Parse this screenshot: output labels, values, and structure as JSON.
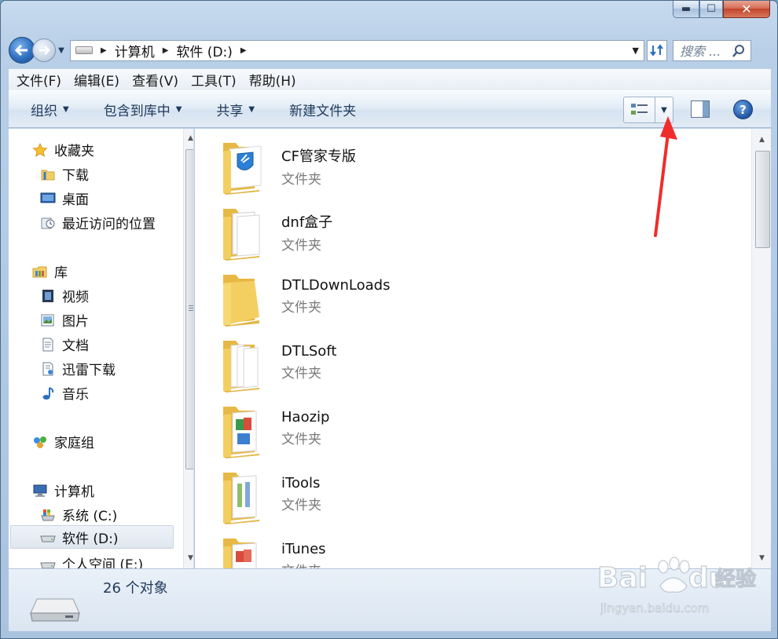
{
  "window": {
    "caption_buttons": {
      "minimize": "▬",
      "maximize": "☐",
      "close": "✕"
    }
  },
  "address_bar": {
    "breadcrumb": [
      "计算机",
      "软件 (D:)"
    ],
    "search_placeholder": "搜索 ..."
  },
  "menu": [
    "文件(F)",
    "编辑(E)",
    "查看(V)",
    "工具(T)",
    "帮助(H)"
  ],
  "toolbar": {
    "commands": [
      {
        "label": "组织",
        "has_dropdown": true
      },
      {
        "label": "包含到库中",
        "has_dropdown": true
      },
      {
        "label": "共享",
        "has_dropdown": true
      },
      {
        "label": "新建文件夹",
        "has_dropdown": false
      }
    ],
    "help_label": "?"
  },
  "sidebar": {
    "groups": [
      {
        "label": "收藏夹",
        "icon": "star-icon",
        "items": [
          {
            "label": "下载",
            "icon": "downloads-folder-icon"
          },
          {
            "label": "桌面",
            "icon": "desktop-icon"
          },
          {
            "label": "最近访问的位置",
            "icon": "recent-places-icon"
          }
        ]
      },
      {
        "label": "库",
        "icon": "library-icon",
        "items": [
          {
            "label": "视频",
            "icon": "video-library-icon"
          },
          {
            "label": "图片",
            "icon": "pictures-library-icon"
          },
          {
            "label": "文档",
            "icon": "documents-library-icon"
          },
          {
            "label": "迅雷下载",
            "icon": "thunder-download-icon"
          },
          {
            "label": "音乐",
            "icon": "music-library-icon"
          }
        ]
      },
      {
        "label": "家庭组",
        "icon": "homegroup-icon",
        "items": []
      },
      {
        "label": "计算机",
        "icon": "computer-icon",
        "items": [
          {
            "label": "系统 (C:)",
            "icon": "system-drive-icon"
          },
          {
            "label": "软件 (D:)",
            "icon": "drive-icon",
            "selected": true
          },
          {
            "label": "个人空间 (E:)",
            "icon": "drive-icon"
          }
        ]
      }
    ]
  },
  "files": [
    {
      "name": "CF管家专版",
      "type": "文件夹",
      "icon": "folder-shield-icon"
    },
    {
      "name": "dnf盒子",
      "type": "文件夹",
      "icon": "folder-documents-icon"
    },
    {
      "name": "DTLDownLoads",
      "type": "文件夹",
      "icon": "folder-empty-icon"
    },
    {
      "name": "DTLSoft",
      "type": "文件夹",
      "icon": "folder-documents-icon"
    },
    {
      "name": "Haozip",
      "type": "文件夹",
      "icon": "folder-images-icon"
    },
    {
      "name": "iTools",
      "type": "文件夹",
      "icon": "folder-documents-icon"
    },
    {
      "name": "iTunes",
      "type": "文件夹",
      "icon": "folder-images-icon"
    }
  ],
  "details": {
    "count": "26 个对象",
    "icon": "drive-icon"
  },
  "watermark": {
    "brand_left": "Bai",
    "brand_right": "du",
    "suffix": "经验",
    "url": "jingyan.baidu.com"
  },
  "colors": {
    "accent": "#1e395b",
    "annotation_arrow": "#f02c2c",
    "folder_yellow": "#f3cf62"
  }
}
